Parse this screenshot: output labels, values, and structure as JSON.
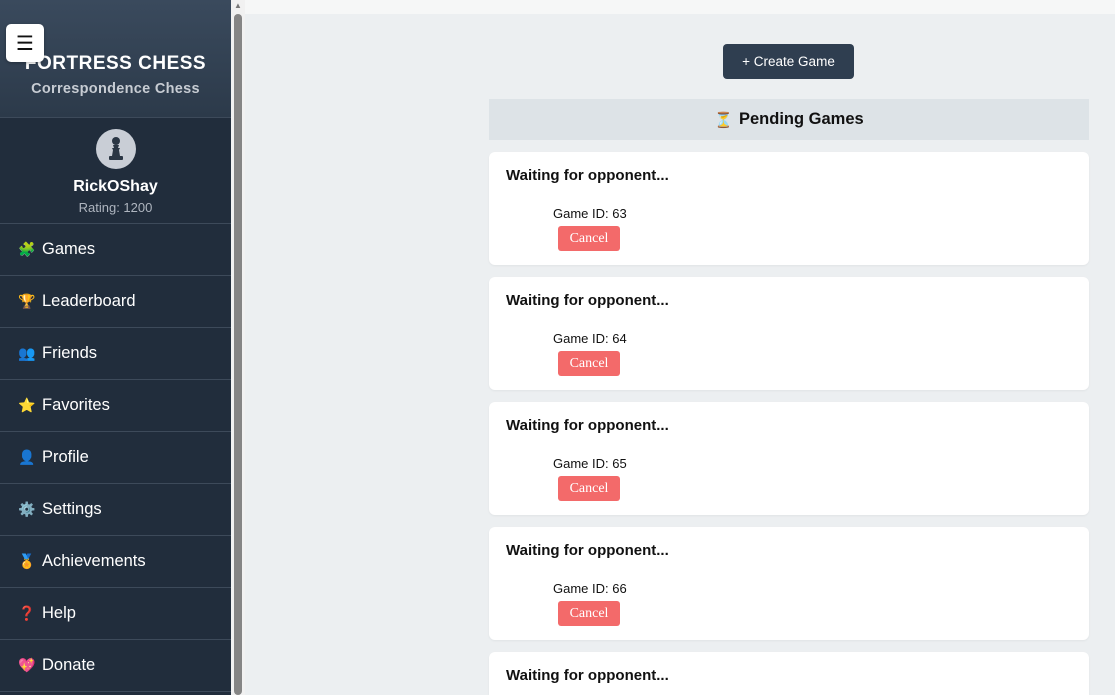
{
  "brand": {
    "title": "FORTRESS CHESS",
    "subtitle": "Correspondence Chess"
  },
  "menu_icon": "hamburger-icon",
  "user": {
    "name": "RickOShay",
    "rating": "Rating: 1200",
    "avatar_icon": "pawn-icon"
  },
  "nav": [
    {
      "label": "Games",
      "icon": "🧩"
    },
    {
      "label": "Leaderboard",
      "icon": "🏆"
    },
    {
      "label": "Friends",
      "icon": "👥"
    },
    {
      "label": "Favorites",
      "icon": "⭐"
    },
    {
      "label": "Profile",
      "icon": "👤"
    },
    {
      "label": "Settings",
      "icon": "⚙️"
    },
    {
      "label": "Achievements",
      "icon": "🏅"
    },
    {
      "label": "Help",
      "icon": "❓"
    },
    {
      "label": "Donate",
      "icon": "💖"
    }
  ],
  "main": {
    "create_label": "+ Create Game",
    "pending_icon": "⏳",
    "pending_title": "Pending Games",
    "games": [
      {
        "title": "Waiting for opponent...",
        "id": "Game ID: 63",
        "cancel": "Cancel"
      },
      {
        "title": "Waiting for opponent...",
        "id": "Game ID: 64",
        "cancel": "Cancel"
      },
      {
        "title": "Waiting for opponent...",
        "id": "Game ID: 65",
        "cancel": "Cancel"
      },
      {
        "title": "Waiting for opponent...",
        "id": "Game ID: 66",
        "cancel": "Cancel"
      },
      {
        "title": "Waiting for opponent...",
        "id": "",
        "cancel": ""
      }
    ]
  },
  "colors": {
    "sidebar": "#212d3c",
    "primary_button": "#2f3e50",
    "cancel_button": "#f36a6a",
    "background": "#eceff1"
  }
}
